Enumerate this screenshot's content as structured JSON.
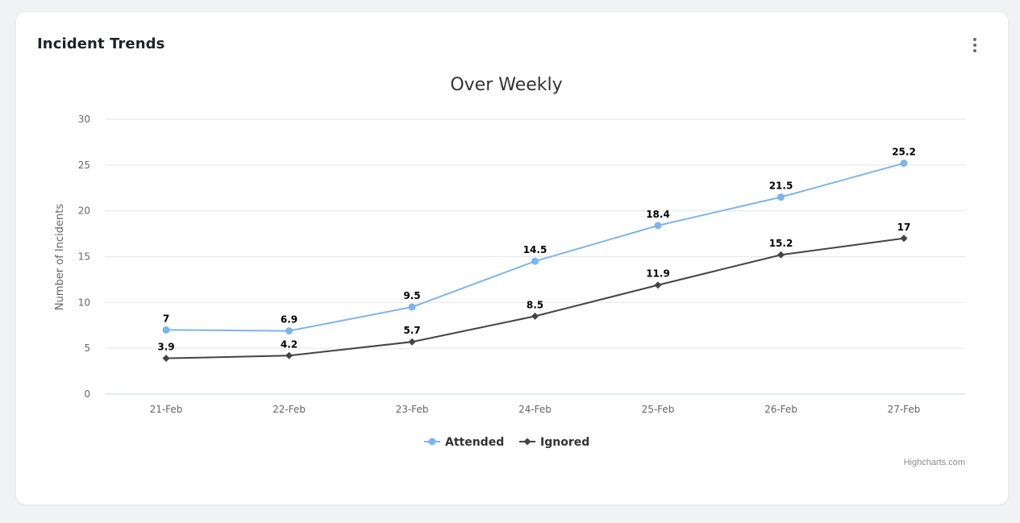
{
  "card": {
    "title": "Incident Trends",
    "menu_icon": "more-vertical-icon"
  },
  "chart_data": {
    "type": "line",
    "title": "Over Weekly",
    "xlabel": "",
    "ylabel": "Number of Incidents",
    "categories": [
      "21-Feb",
      "22-Feb",
      "23-Feb",
      "24-Feb",
      "25-Feb",
      "26-Feb",
      "27-Feb"
    ],
    "ylim": [
      0,
      30
    ],
    "yticks": [
      0,
      5,
      10,
      15,
      20,
      25,
      30
    ],
    "grid": true,
    "legend_position": "bottom-center",
    "data_labels": true,
    "series": [
      {
        "name": "Attended",
        "color": "#7cb5ec",
        "marker": "circle",
        "values": [
          7,
          6.9,
          9.5,
          14.5,
          18.4,
          21.5,
          25.2
        ]
      },
      {
        "name": "Ignored",
        "color": "#434348",
        "marker": "diamond",
        "values": [
          3.9,
          4.2,
          5.7,
          8.5,
          11.9,
          15.2,
          17
        ]
      }
    ],
    "credit": "Highcharts.com"
  }
}
